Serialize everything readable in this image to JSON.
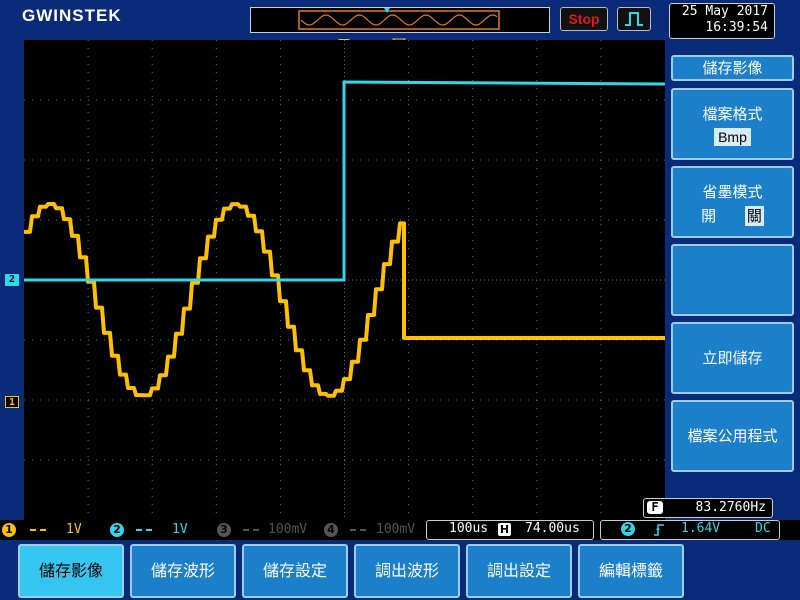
{
  "header": {
    "logo": "GWINSTEK",
    "run_state": "Stop",
    "date": "25 May 2017",
    "time": "16:39:54"
  },
  "colors": {
    "ch1": "#ffc000",
    "ch2": "#2fd8e8",
    "menu_bg": "#1c7fc9",
    "menu_active": "#35c6f0",
    "stop_text": "#e01818",
    "grid": "#6b6b6b"
  },
  "markers": {
    "ch1": "1",
    "ch2": "2"
  },
  "side_menu": {
    "title": "儲存影像",
    "file_format": {
      "label": "檔案格式",
      "value": "Bmp"
    },
    "ink_saver": {
      "label": "省墨模式",
      "on": "開",
      "off": "關",
      "selected": "關"
    },
    "empty": "",
    "save_now": "立即儲存",
    "file_utilities": "檔案公用程式"
  },
  "frequency": {
    "icon_letter": "F",
    "value": "83.2760Hz"
  },
  "status_bar": {
    "ch1": {
      "num": "1",
      "scale": "1V"
    },
    "ch2": {
      "num": "2",
      "scale": "1V"
    },
    "ch3": {
      "num": "3",
      "scale": "100mV"
    },
    "ch4": {
      "num": "4",
      "scale": "100mV"
    },
    "timebase": "100us",
    "h_icon": "H",
    "h_position": "74.00us",
    "trigger": {
      "source": "2",
      "slope_icon": "rising-edge-icon",
      "level": "1.64V",
      "coupling": "DC"
    }
  },
  "bottom_menu": [
    "儲存影像",
    "儲存波形",
    "儲存設定",
    "調出波形",
    "調出設定",
    "編輯標籤"
  ],
  "icons": {
    "trigger_mode": "pulse-trigger-icon",
    "trigger_position": "trigger-position-arrow-icon"
  }
}
